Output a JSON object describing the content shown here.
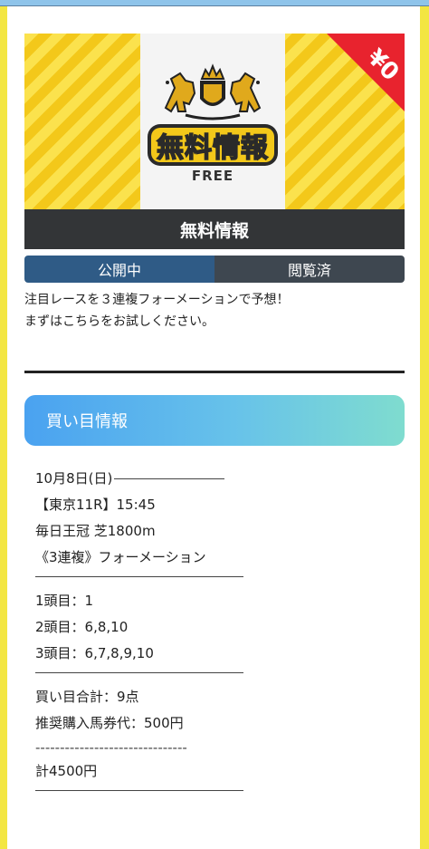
{
  "banner": {
    "title_text": "無料情報",
    "sub_text": "FREE",
    "price_badge": "¥0",
    "caption": "無料情報",
    "colors": {
      "stripe_a": "#fbe24d",
      "stripe_b": "#f3c81a",
      "corner": "#e8232e",
      "caption_bg": "#333537"
    },
    "emblem_icon": "horses-crest-icon"
  },
  "status": {
    "published": "公開中",
    "viewed": "閲覧済"
  },
  "description": {
    "line1": "注目レースを３連複フォーメーションで予想！",
    "line2": "まずはこちらをお試しください。"
  },
  "buy_card": {
    "header": "買い目情報",
    "date": "10月8日(日)",
    "race": "【東京11R】15:45",
    "race_name": "毎日王冠 芝1800m",
    "bet_type": "《3連複》フォーメーション",
    "first": "1頭目：1",
    "second": "2頭目：6,8,10",
    "third": "3頭目：6,7,8,9,10",
    "total_points": "買い目合計：9点",
    "recommended": "推奨購入馬券代：500円",
    "dashes": "-------------------------------",
    "total": "計4500円"
  }
}
